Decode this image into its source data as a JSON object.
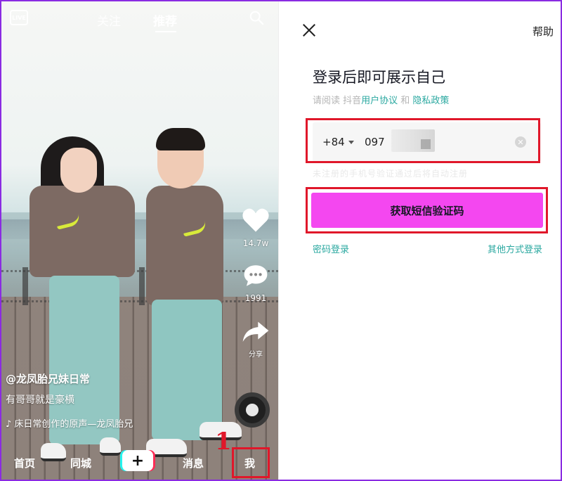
{
  "feed": {
    "live_label": "LIVE",
    "top_tabs": [
      {
        "label": "关注",
        "active": false
      },
      {
        "label": "推荐",
        "active": true
      }
    ],
    "rail": {
      "likes": "14.7w",
      "comments": "1991",
      "share": "分享"
    },
    "author": "@龙凤胎兄妹日常",
    "description": "有哥哥就是豪横",
    "music": "♪ 床日常创作的原声—龙凤胎兄",
    "step_number": "1",
    "bottom_nav": {
      "home": "首页",
      "city": "同城",
      "plus": "+",
      "messages": "消息",
      "me": "我"
    }
  },
  "login": {
    "help": "帮助",
    "title": "登录后即可展示自己",
    "agree_prefix": "请阅读 抖音",
    "user_agreement": "用户协议",
    "agree_and": " 和 ",
    "privacy_policy": "隐私政策",
    "country_code": "+84",
    "phone_value": "097",
    "hint": "未注册的手机号验证通过后将自动注册",
    "sms_button": "获取短信验证码",
    "password_login": "密码登录",
    "other_login": "其他方式登录"
  },
  "colors": {
    "highlight_red": "#e0172a",
    "sms_button": "#f447f0",
    "link_teal": "#2aa8a0"
  }
}
